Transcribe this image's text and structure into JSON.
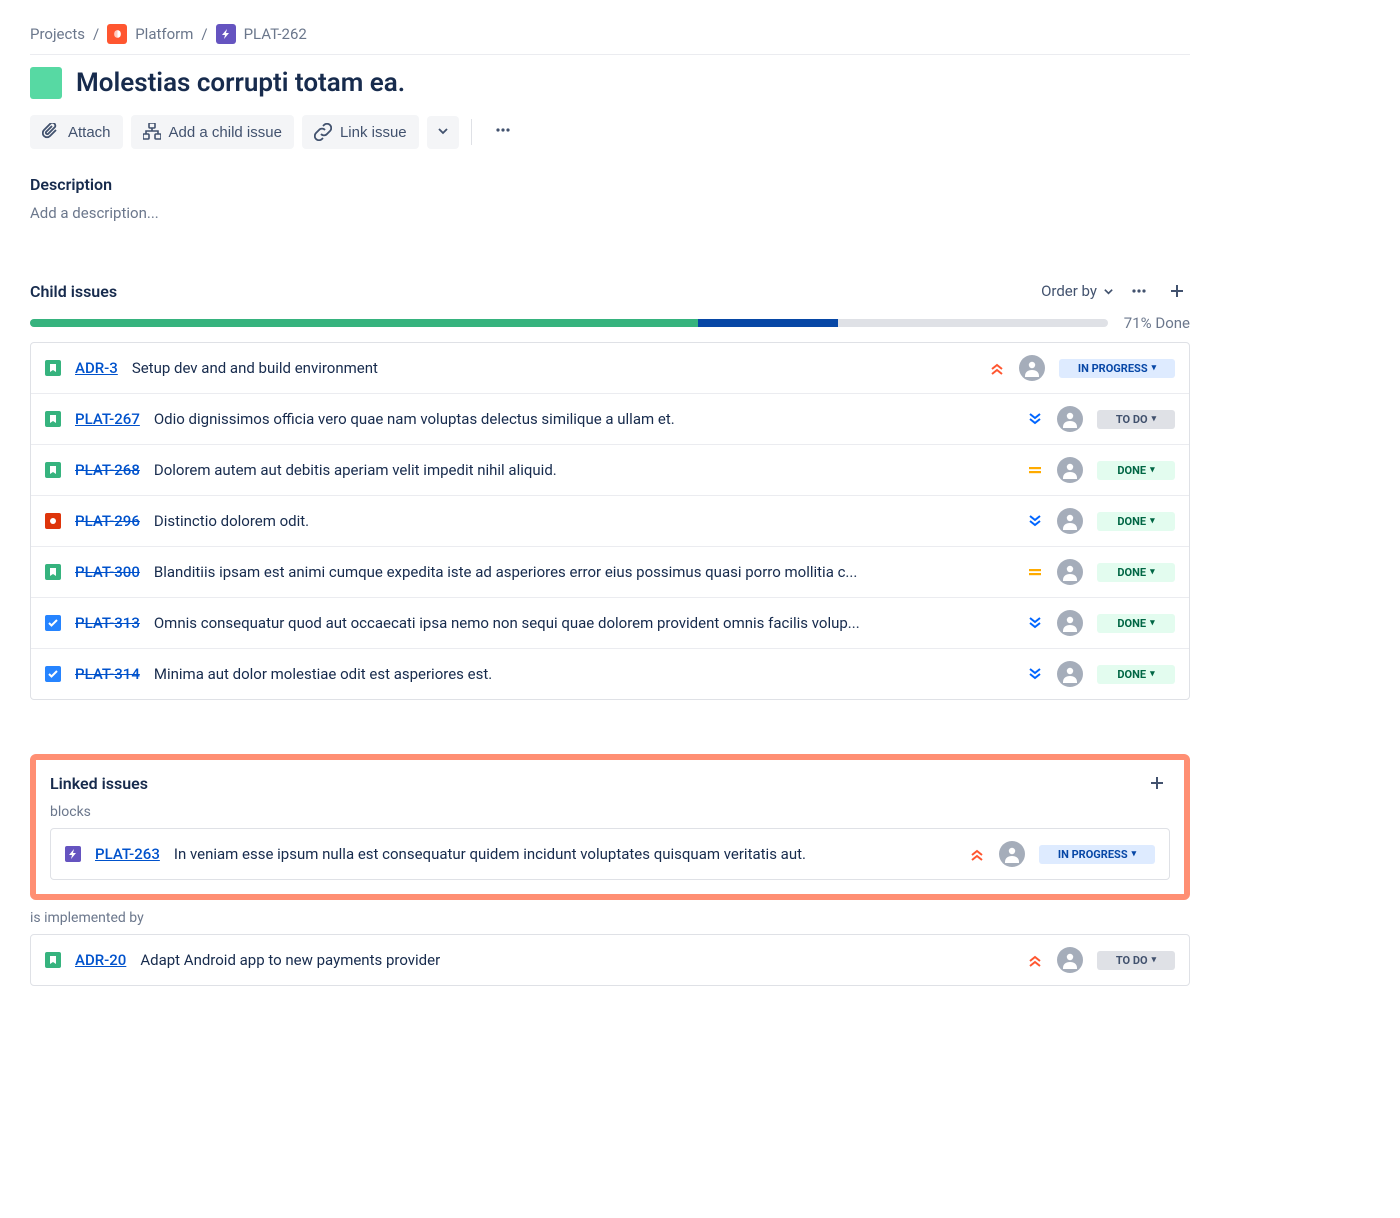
{
  "breadcrumb": {
    "projects": "Projects",
    "project_name": "Platform",
    "issue_key": "PLAT-262"
  },
  "title": "Molestias corrupti totam ea.",
  "toolbar": {
    "attach": "Attach",
    "add_child": "Add a child issue",
    "link_issue": "Link issue"
  },
  "description": {
    "label": "Description",
    "placeholder": "Add a description..."
  },
  "child_issues": {
    "label": "Child issues",
    "order_by": "Order by",
    "progress_done_pct": 62,
    "progress_inprog_pct": 13,
    "progress_text": "71% Done",
    "items": [
      {
        "type": "story",
        "key": "ADR-3",
        "struck": false,
        "summary": "Setup dev and and build environment",
        "priority": "highest",
        "status": "IN PROGRESS",
        "status_kind": "inprogress"
      },
      {
        "type": "story",
        "key": "PLAT-267",
        "struck": false,
        "summary": "Odio dignissimos officia vero quae nam voluptas delectus similique a ullam et.",
        "priority": "lowest",
        "status": "TO DO",
        "status_kind": "todo"
      },
      {
        "type": "story",
        "key": "PLAT-268",
        "struck": true,
        "summary": "Dolorem autem aut debitis aperiam velit impedit nihil aliquid.",
        "priority": "medium",
        "status": "DONE",
        "status_kind": "done"
      },
      {
        "type": "bug",
        "key": "PLAT-296",
        "struck": true,
        "summary": "Distinctio dolorem odit.",
        "priority": "lowest",
        "status": "DONE",
        "status_kind": "done"
      },
      {
        "type": "story",
        "key": "PLAT-300",
        "struck": true,
        "summary": "Blanditiis ipsam est animi cumque expedita iste ad asperiores error eius possimus quasi porro mollitia c...",
        "priority": "medium",
        "status": "DONE",
        "status_kind": "done"
      },
      {
        "type": "task",
        "key": "PLAT-313",
        "struck": true,
        "summary": "Omnis consequatur quod aut occaecati ipsa nemo non sequi quae dolorem provident omnis facilis volup...",
        "priority": "lowest",
        "status": "DONE",
        "status_kind": "done"
      },
      {
        "type": "task",
        "key": "PLAT-314",
        "struck": true,
        "summary": "Minima aut dolor molestiae odit est asperiores est.",
        "priority": "lowest",
        "status": "DONE",
        "status_kind": "done"
      }
    ]
  },
  "linked_issues": {
    "label": "Linked issues",
    "blocks_label": "blocks",
    "blocks": [
      {
        "type": "epic",
        "key": "PLAT-263",
        "struck": false,
        "summary": "In veniam esse ipsum nulla est consequatur quidem incidunt voluptates quisquam veritatis aut.",
        "priority": "highest",
        "status": "IN PROGRESS",
        "status_kind": "inprogress"
      }
    ],
    "implemented_label": "is implemented by",
    "implemented": [
      {
        "type": "story",
        "key": "ADR-20",
        "struck": false,
        "summary": "Adapt Android app to new payments provider",
        "priority": "highest",
        "status": "TO DO",
        "status_kind": "todo"
      }
    ]
  }
}
